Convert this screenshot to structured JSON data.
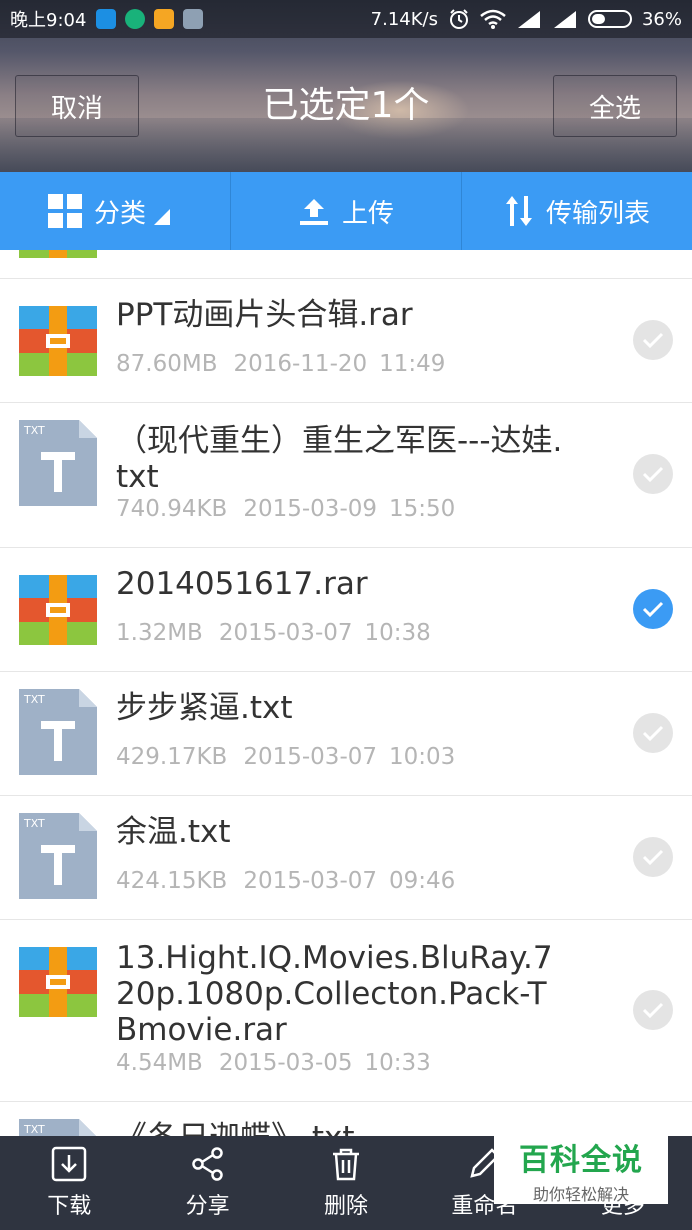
{
  "status_bar": {
    "time": "晚上9:04",
    "network_speed": "7.14K/s",
    "battery": "36%",
    "battery_level": 0.36,
    "notification_icons": [
      "alipay-icon",
      "wechat-mini-icon",
      "game-icon",
      "message-icon"
    ]
  },
  "header": {
    "cancel_label": "取消",
    "title": "已选定1个",
    "select_all_label": "全选"
  },
  "toolbar": {
    "category_label": "分类",
    "upload_label": "上传",
    "transfer_label": "传输列表"
  },
  "files": [
    {
      "name": "PPT动画片头合辑.rar",
      "size": "87.60MB",
      "date": "2016-11-20",
      "time": "11:49",
      "type": "rar",
      "selected": false
    },
    {
      "name": "（现代重生）重生之军医---达娃.txt",
      "size": "740.94KB",
      "date": "2015-03-09",
      "time": "15:50",
      "type": "txt",
      "selected": false
    },
    {
      "name": "2014051617.rar",
      "size": "1.32MB",
      "date": "2015-03-07",
      "time": "10:38",
      "type": "rar",
      "selected": true
    },
    {
      "name": "步步紧逼.txt",
      "size": "429.17KB",
      "date": "2015-03-07",
      "time": "10:03",
      "type": "txt",
      "selected": false
    },
    {
      "name": "余温.txt",
      "size": "424.15KB",
      "date": "2015-03-07",
      "time": "09:46",
      "type": "txt",
      "selected": false
    },
    {
      "name": "13.Hight.IQ.Movies.BluRay.720p.1080p.Collecton.Pack-TBmovie.rar",
      "size": "4.54MB",
      "date": "2015-03-05",
      "time": "10:33",
      "type": "rar",
      "selected": false
    },
    {
      "name": "《冬日迦蝶》.txt",
      "size": "",
      "date": "",
      "time": "",
      "type": "txt",
      "selected": false
    }
  ],
  "bottom_bar": {
    "download_label": "下载",
    "share_label": "分享",
    "delete_label": "删除",
    "rename_label": "重命名",
    "more_label": "更多"
  },
  "watermark": {
    "title": "百科全说",
    "subtitle": "助你轻松解决"
  },
  "colors": {
    "accent": "#3b9bf4",
    "bottom_bar": "#2f3440",
    "watermark_green": "#23a64e"
  }
}
